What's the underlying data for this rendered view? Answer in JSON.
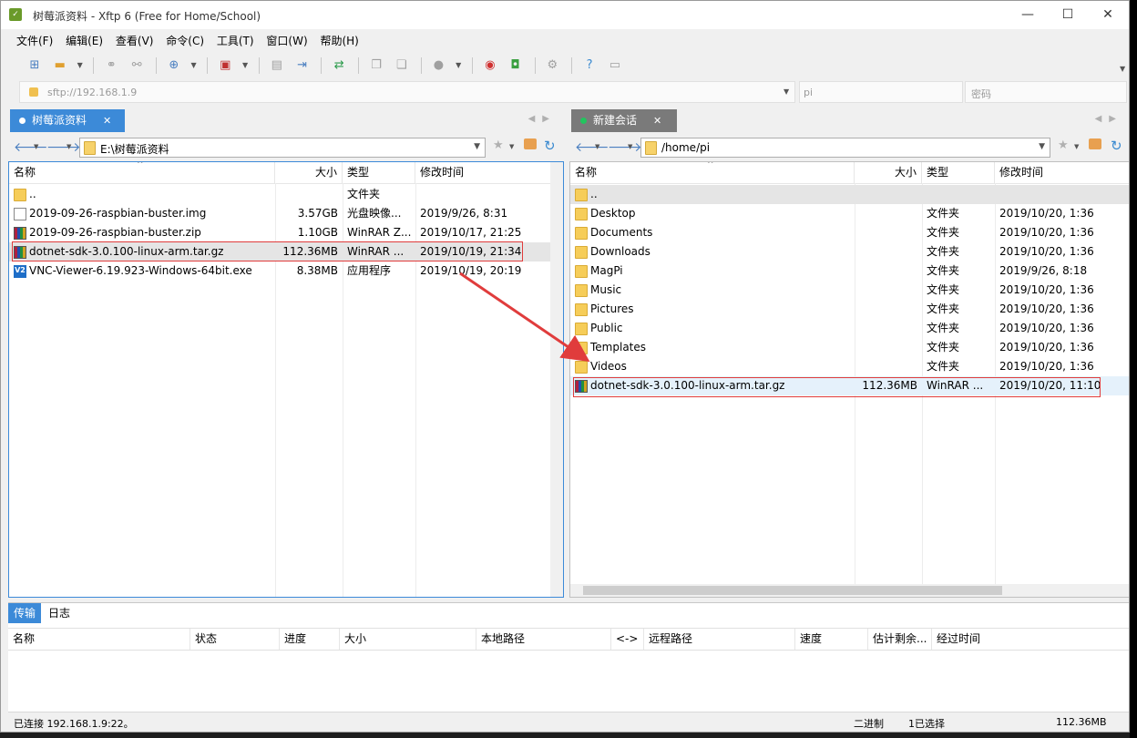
{
  "window": {
    "title": "树莓派资料 - Xftp 6 (Free for Home/School)",
    "app_icon": "xftp-icon",
    "minimize": "—",
    "maximize": "☐",
    "close": "✕"
  },
  "menu": [
    "文件(F)",
    "编辑(E)",
    "查看(V)",
    "命令(C)",
    "工具(T)",
    "窗口(W)",
    "帮助(H)"
  ],
  "address_bar": {
    "host": "sftp://192.168.1.9",
    "user_placeholder": "pi",
    "password_placeholder": "密码"
  },
  "left_pane": {
    "tab_label": "树莓派资料",
    "tab_dot_color": "#ffffff",
    "path": "E:\\树莓派资料",
    "columns": [
      "名称",
      "大小",
      "类型",
      "修改时间"
    ],
    "files": [
      {
        "name": "..",
        "size": "",
        "type": "文件夹",
        "modified": "",
        "icon": "folder-icon"
      },
      {
        "name": "2019-09-26-raspbian-buster.img",
        "size": "3.57GB",
        "type": "光盘映像...",
        "modified": "2019/9/26, 8:31",
        "icon": "disc-image-icon"
      },
      {
        "name": "2019-09-26-raspbian-buster.zip",
        "size": "1.10GB",
        "type": "WinRAR Z...",
        "modified": "2019/10/17, 21:25",
        "icon": "winrar-icon"
      },
      {
        "name": "dotnet-sdk-3.0.100-linux-arm.tar.gz",
        "size": "112.36MB",
        "type": "WinRAR ...",
        "modified": "2019/10/19, 21:34",
        "icon": "winrar-icon"
      },
      {
        "name": "VNC-Viewer-6.19.923-Windows-64bit.exe",
        "size": "8.38MB",
        "type": "应用程序",
        "modified": "2019/10/19, 20:19",
        "icon": "vnc-icon"
      }
    ]
  },
  "right_pane": {
    "tab_label": "新建会话",
    "tab_dot_color": "#22c55e",
    "path": "/home/pi",
    "columns": [
      "名称",
      "大小",
      "类型",
      "修改时间"
    ],
    "files": [
      {
        "name": "..",
        "size": "",
        "type": "",
        "modified": "",
        "icon": "folder-icon"
      },
      {
        "name": "Desktop",
        "size": "",
        "type": "文件夹",
        "modified": "2019/10/20, 1:36",
        "icon": "folder-icon"
      },
      {
        "name": "Documents",
        "size": "",
        "type": "文件夹",
        "modified": "2019/10/20, 1:36",
        "icon": "folder-icon"
      },
      {
        "name": "Downloads",
        "size": "",
        "type": "文件夹",
        "modified": "2019/10/20, 1:36",
        "icon": "folder-icon"
      },
      {
        "name": "MagPi",
        "size": "",
        "type": "文件夹",
        "modified": "2019/9/26, 8:18",
        "icon": "folder-icon"
      },
      {
        "name": "Music",
        "size": "",
        "type": "文件夹",
        "modified": "2019/10/20, 1:36",
        "icon": "folder-icon"
      },
      {
        "name": "Pictures",
        "size": "",
        "type": "文件夹",
        "modified": "2019/10/20, 1:36",
        "icon": "folder-icon"
      },
      {
        "name": "Public",
        "size": "",
        "type": "文件夹",
        "modified": "2019/10/20, 1:36",
        "icon": "folder-icon"
      },
      {
        "name": "Templates",
        "size": "",
        "type": "文件夹",
        "modified": "2019/10/20, 1:36",
        "icon": "folder-icon"
      },
      {
        "name": "Videos",
        "size": "",
        "type": "文件夹",
        "modified": "2019/10/20, 1:36",
        "icon": "folder-icon"
      },
      {
        "name": "dotnet-sdk-3.0.100-linux-arm.tar.gz",
        "size": "112.36MB",
        "type": "WinRAR ...",
        "modified": "2019/10/20, 11:10",
        "icon": "winrar-icon"
      }
    ]
  },
  "bottom": {
    "tabs": [
      "传输",
      "日志"
    ],
    "columns": [
      "名称",
      "状态",
      "进度",
      "大小",
      "本地路径",
      "<->",
      "远程路径",
      "速度",
      "估计剩余...",
      "经过时间"
    ]
  },
  "status_bar": {
    "connection": "已连接 192.168.1.9:22。",
    "mode": "二进制",
    "selected": "1已选择",
    "size": "112.36MB"
  },
  "colors": {
    "accent": "#3c8ad8",
    "highlight_box": "#e03c3c",
    "arrow": "#e03c3c"
  }
}
